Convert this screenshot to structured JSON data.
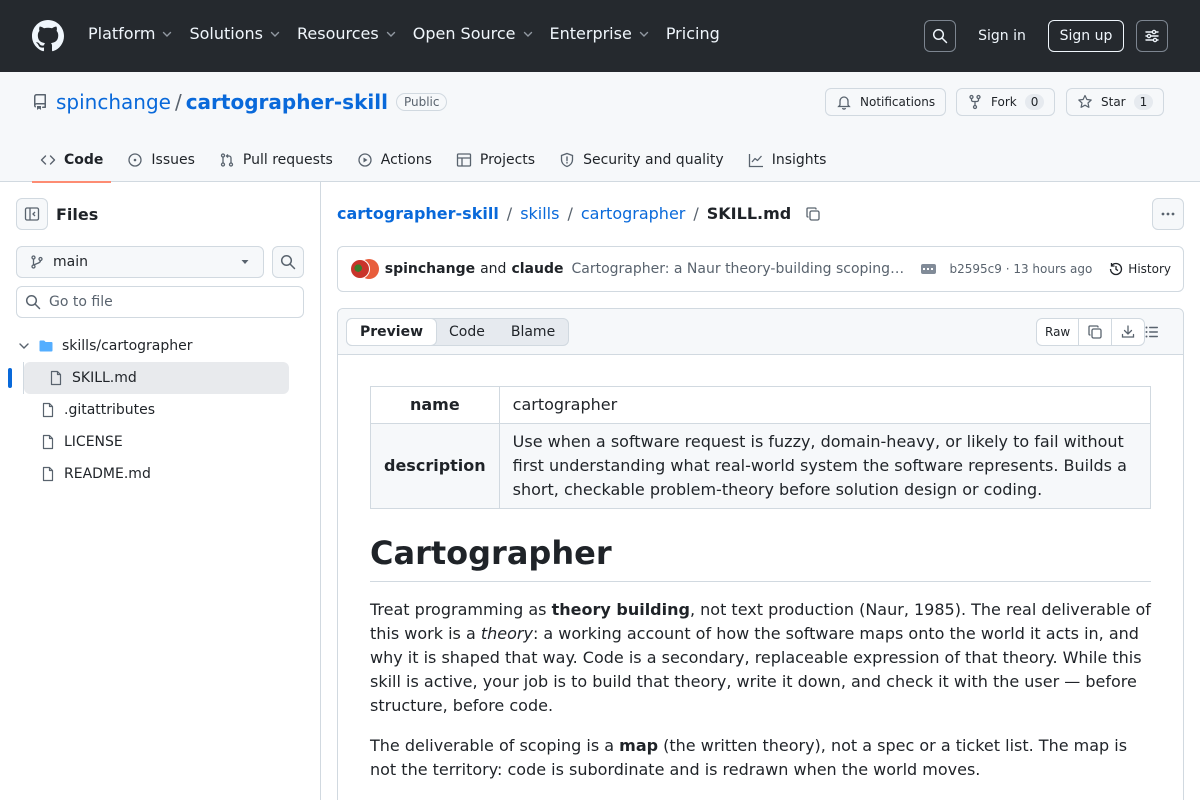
{
  "header": {
    "nav": [
      "Platform",
      "Solutions",
      "Resources",
      "Open Source",
      "Enterprise",
      "Pricing"
    ],
    "nav_has_caret": [
      true,
      true,
      true,
      true,
      true,
      false
    ],
    "sign_in": "Sign in",
    "sign_up": "Sign up"
  },
  "repo": {
    "owner": "spinchange",
    "separator": "/",
    "name": "cartographer-skill",
    "visibility": "Public",
    "notifications": "Notifications",
    "fork_label": "Fork",
    "fork_count": "0",
    "star_label": "Star",
    "star_count": "1",
    "tabs": [
      "Code",
      "Issues",
      "Pull requests",
      "Actions",
      "Projects",
      "Security and quality",
      "Insights"
    ],
    "tab_icons": [
      "code-icon",
      "issue-icon",
      "pull-request-icon",
      "play-icon",
      "table-icon",
      "shield-icon",
      "graph-icon"
    ]
  },
  "sidebar": {
    "title": "Files",
    "branch": "main",
    "goto_placeholder": "Go to file",
    "tree": [
      {
        "name": "skills/cartographer",
        "type": "folder",
        "expanded": true
      },
      {
        "name": "SKILL.md",
        "type": "file",
        "selected": true
      },
      {
        "name": ".gitattributes",
        "type": "file"
      },
      {
        "name": "LICENSE",
        "type": "file"
      },
      {
        "name": "README.md",
        "type": "file"
      }
    ]
  },
  "breadcrumb": {
    "repo": "cartographer-skill",
    "p1": "skills",
    "p2": "cartographer",
    "file": "SKILL.md",
    "sep": "/"
  },
  "commit": {
    "author1": "spinchange",
    "and": "and",
    "author2": "claude",
    "message": "Cartographer: a Naur theory-building scoping skill fo…",
    "sha_time": "b2595c9 · 13 hours ago",
    "history": "History"
  },
  "file_toolbar": {
    "views": [
      "Preview",
      "Code",
      "Blame"
    ],
    "raw": "Raw"
  },
  "markdown": {
    "frontmatter": [
      {
        "key": "name",
        "value": "cartographer"
      },
      {
        "key": "description",
        "value": "Use when a software request is fuzzy, domain-heavy, or likely to fail without first understanding what real-world system the software represents. Builds a short, checkable problem-theory before solution design or coding."
      }
    ],
    "h1": "Cartographer",
    "p1": {
      "a": "Treat programming as ",
      "b": "theory building",
      "c": ", not text production (Naur, 1985). The real deliverable of this work is a ",
      "d": "theory",
      "e": ": a working account of how the software maps onto the world it acts in, and why it is shaped that way. Code is a secondary, replaceable expression of that theory. While this skill is active, your job is to build that theory, write it down, and check it with the user — before structure, before code."
    },
    "p2": {
      "a": "The deliverable of scoping is a ",
      "b": "map",
      "c": " (the written theory), not a spec or a ticket list. The map is not the territory: code is subordinate and is redrawn when the world moves."
    }
  }
}
